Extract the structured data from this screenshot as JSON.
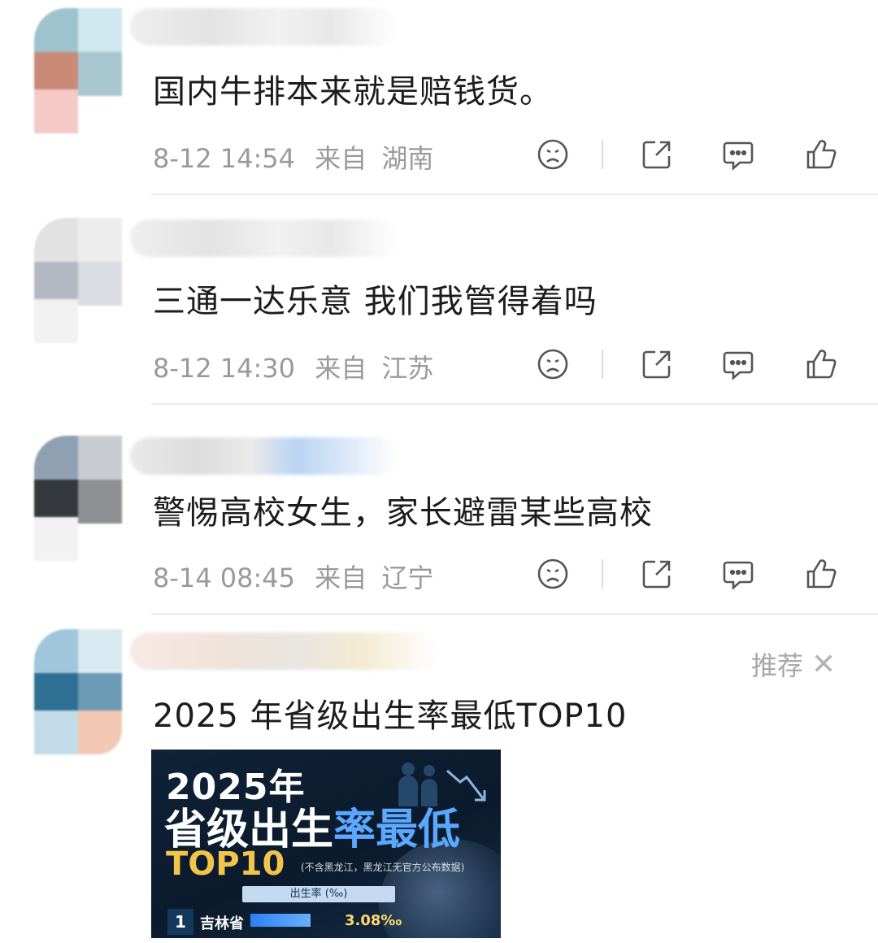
{
  "comments": [
    {
      "content": "国内牛排本来就是赔钱货。",
      "time": "8-12 14:54",
      "from_label": "来自",
      "location": "湖南"
    },
    {
      "content": "三通一达乐意 我们我管得着吗",
      "time": "8-12 14:30",
      "from_label": "来自",
      "location": "江苏"
    },
    {
      "content": "警惕高校女生，家长避雷某些高校",
      "time": "8-14 08:45",
      "from_label": "来自",
      "location": "辽宁"
    }
  ],
  "recommended": {
    "tag": "推荐",
    "close_symbol": "✕",
    "content": "2025 年省级出生率最低TOP10",
    "image": {
      "year": "2025年",
      "title_white": "省级出生",
      "title_blue": "率最低",
      "top10": "TOP10",
      "note": "(不含黑龙江，黑龙江无官方公布数据)",
      "column_header": "出生率 (‰)",
      "row_rank": "1",
      "row_province": "吉林省",
      "row_rate": "3.08‰",
      "row_bar_fraction": 0.62
    }
  },
  "icons": [
    "dislike-icon",
    "share-icon",
    "comment-icon",
    "like-icon",
    "close-icon"
  ],
  "colors": {
    "meta_text": "#9a9a9a",
    "content_text": "#1c1c1c",
    "divider": "#ececec",
    "icon": "#555555",
    "image_bg": "#0f2238",
    "image_accent_blue": "#5aa8ff",
    "image_accent_gold": "#f2c44a"
  }
}
